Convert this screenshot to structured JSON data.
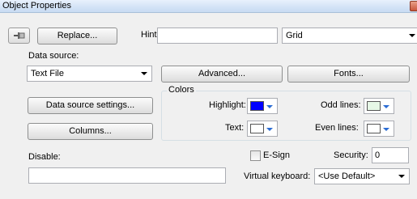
{
  "window": {
    "title": "Object Properties"
  },
  "toolbar": {
    "replace_label": "Replace...",
    "hint_label": "Hint:",
    "hint_value": "",
    "type_combo_value": "Grid"
  },
  "data_source": {
    "label": "Data source:",
    "selected": "Text File",
    "advanced_label": "Advanced...",
    "fonts_label": "Fonts...",
    "settings_label": "Data source settings...",
    "columns_label": "Columns..."
  },
  "colors": {
    "group_label": "Colors",
    "highlight_label": "Highlight:",
    "highlight_color": "#0000ff",
    "text_label": "Text:",
    "text_color": "#ffffff",
    "odd_lines_label": "Odd lines:",
    "odd_lines_color": "#e6f8e6",
    "even_lines_label": "Even lines:",
    "even_lines_color": "#ffffff"
  },
  "disable": {
    "label": "Disable:",
    "value": ""
  },
  "esign": {
    "label": "E-Sign",
    "checked": false
  },
  "security": {
    "label": "Security:",
    "value": "0"
  },
  "virtual_keyboard": {
    "label": "Virtual keyboard:",
    "value": "<Use Default>"
  }
}
